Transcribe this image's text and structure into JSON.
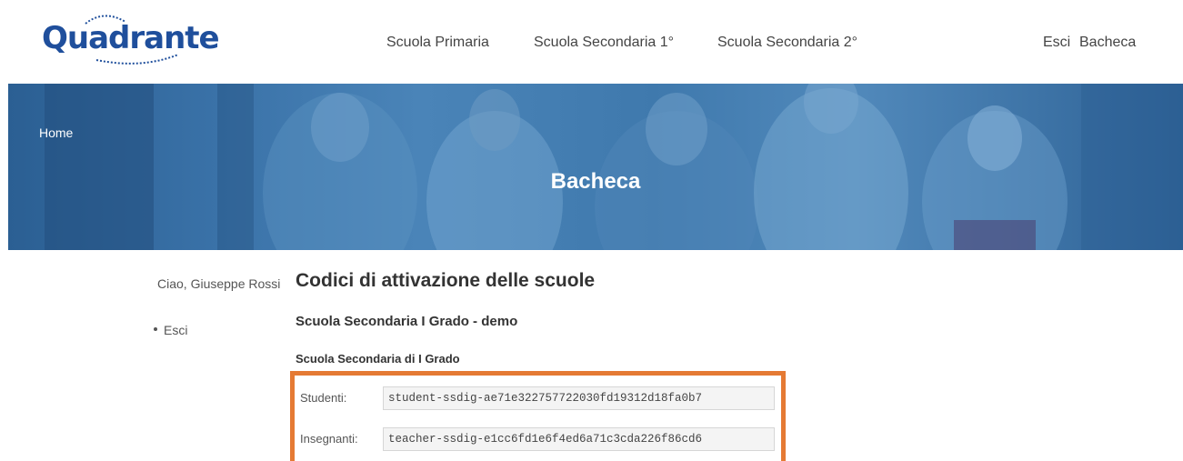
{
  "brand": {
    "logo_text": "Quadrante",
    "color": "#1f4f9c"
  },
  "nav": {
    "items": [
      {
        "label": "Scuola Primaria"
      },
      {
        "label": "Scuola Secondaria 1°"
      },
      {
        "label": "Scuola Secondaria 2°"
      }
    ],
    "right": [
      {
        "label": "Esci"
      },
      {
        "label": "Bacheca"
      }
    ]
  },
  "banner": {
    "breadcrumb": "Home",
    "title": "Bacheca"
  },
  "sidebar": {
    "greeting": "Ciao, Giuseppe Rossi",
    "links": [
      {
        "label": "Esci"
      }
    ]
  },
  "main": {
    "title": "Codici di attivazione delle scuole",
    "school_name": "Scuola Secondaria I Grado - demo",
    "grade_title": "Scuola Secondaria di I Grado",
    "codes": [
      {
        "label": "Studenti:",
        "value": "student-ssdig-ae71e322757722030fd19312d18fa0b7"
      },
      {
        "label": "Insegnanti:",
        "value": "teacher-ssdig-e1cc6fd1e6f4ed6a71c3cda226f86cd6"
      }
    ]
  },
  "highlight_color": "#e57a34"
}
